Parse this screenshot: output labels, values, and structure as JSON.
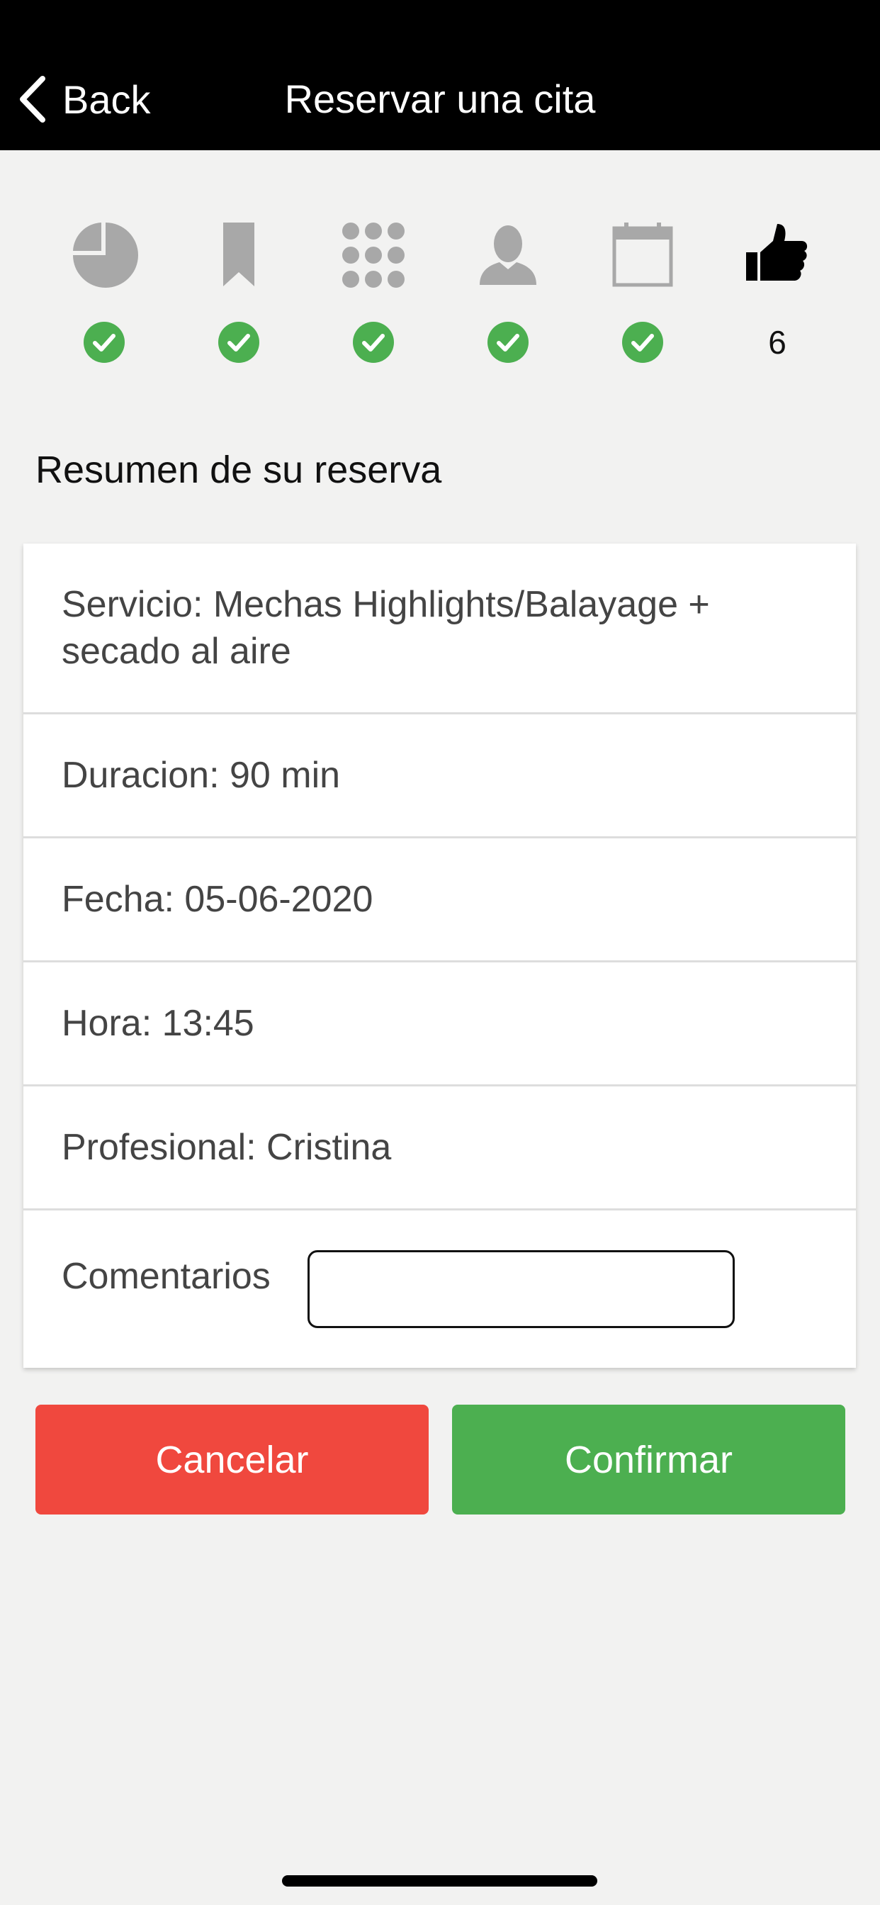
{
  "header": {
    "back_label": "Back",
    "title": "Reservar una cita"
  },
  "steps": [
    {
      "icon": "pie-chart-icon",
      "state": "done"
    },
    {
      "icon": "bookmark-icon",
      "state": "done"
    },
    {
      "icon": "grid-icon",
      "state": "done"
    },
    {
      "icon": "person-icon",
      "state": "done"
    },
    {
      "icon": "calendar-icon",
      "state": "done"
    },
    {
      "icon": "thumbs-up-icon",
      "state": "current",
      "number": "6"
    }
  ],
  "summary": {
    "title": "Resumen de su reserva",
    "servicio": "Servicio: Mechas Highlights/Balayage + secado al aire",
    "duracion": "Duracion: 90 min",
    "fecha": "Fecha: 05-06-2020",
    "hora": "Hora: 13:45",
    "profesional": "Profesional: Cristina",
    "comentarios_label": "Comentarios",
    "comentarios_value": ""
  },
  "actions": {
    "cancel_label": "Cancelar",
    "confirm_label": "Confirmar"
  },
  "colors": {
    "check": "#4caf50",
    "step_done_icon": "#a8a8a8",
    "step_current_icon": "#000000",
    "cancel": "#f0483e",
    "confirm": "#4caf50"
  }
}
